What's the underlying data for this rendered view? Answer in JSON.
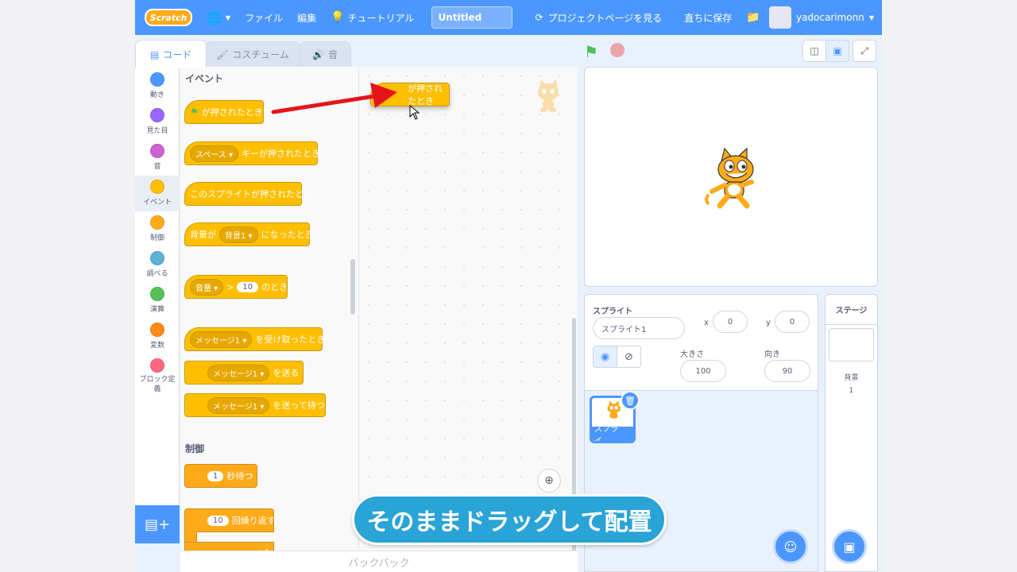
{
  "menubar": {
    "logo": "Scratch",
    "file": "ファイル",
    "edit": "編集",
    "tutorials": "チュートリアル",
    "title_value": "Untitled",
    "see_project_page": "プロジェクトページを見る",
    "save_now": "直ちに保存",
    "username": "yadocarimonn"
  },
  "tabs": {
    "code": "コード",
    "costume": "コスチューム",
    "sound": "音"
  },
  "categories": [
    {
      "label": "動き",
      "color": "#4c97ff"
    },
    {
      "label": "見た目",
      "color": "#9966ff"
    },
    {
      "label": "音",
      "color": "#cf63cf"
    },
    {
      "label": "イベント",
      "color": "#ffbf00"
    },
    {
      "label": "制御",
      "color": "#ffab19"
    },
    {
      "label": "調べる",
      "color": "#5cb1d6"
    },
    {
      "label": "演算",
      "color": "#59c059"
    },
    {
      "label": "変数",
      "color": "#ff8c1a"
    },
    {
      "label": "ブロック定義",
      "color": "#ff6680"
    }
  ],
  "palette": {
    "events_title": "イベント",
    "when_flag": "が押されたとき",
    "space": "スペース",
    "when_key": "キーが押されたとき",
    "when_sprite_clicked": "このスプライトが押されたとき",
    "backdrop_prefix": "背景が",
    "backdrop_option": "背景1",
    "backdrop_suffix": "になったとき",
    "volume": "音量",
    "gt": ">",
    "volume_value": "10",
    "when_suffix": "のとき",
    "message1": "メッセージ1",
    "when_receive": "を受け取ったとき",
    "broadcast": "を送る",
    "broadcast_wait": "を送って待つ",
    "control_title": "制御",
    "wait_value": "1",
    "wait_label": "秒待つ",
    "repeat_value": "10",
    "repeat_label": "回繰り返す"
  },
  "script": {
    "dragged_block_label": "が押されたとき"
  },
  "backpack": "バックパック",
  "sprite_info": {
    "sprite_label": "スプライト",
    "sprite_name": "スプライト1",
    "x_label": "x",
    "x_value": "0",
    "y_label": "y",
    "y_value": "0",
    "size_label": "大きさ",
    "size_value": "100",
    "direction_label": "向き",
    "direction_value": "90"
  },
  "sprite_list": {
    "thumb_label": "スプライ..."
  },
  "stage_panel": {
    "title": "ステージ",
    "backdrops_label": "背景",
    "backdrops_count": "1"
  },
  "caption": "そのままドラッグして配置"
}
